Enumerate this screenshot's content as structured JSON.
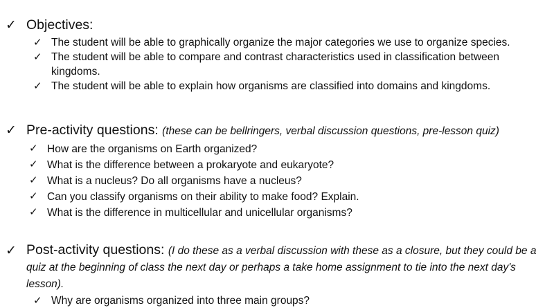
{
  "icons": {
    "bullet": "checkmark-icon"
  },
  "check_glyph": "✓",
  "objectives": {
    "heading": "Objectives:",
    "items": [
      "The student will be able to graphically organize the major categories we use to organize species.",
      "The student will be able to compare and contrast characteristics used in classification between kingdoms.",
      "The student will be able to explain how organisms are classified into domains and kingdoms."
    ]
  },
  "pre_activity": {
    "heading": "Pre-activity questions:",
    "note": "(these can be bellringers, verbal discussion questions, pre-lesson quiz)",
    "items": [
      "How are the organisms on Earth organized?",
      "What is the difference between a prokaryote and eukaryote?",
      "What is a nucleus? Do all organisms have a nucleus?",
      "Can you classify organisms on their ability to make food? Explain.",
      "What is the difference in multicellular and unicellular organisms?"
    ]
  },
  "post_activity": {
    "heading": "Post-activity questions:",
    "note": "(I do these as a verbal discussion with these as a closure, but they could be a quiz at the beginning of class the next day or perhaps a take home assignment to tie into the next day's lesson).",
    "items": [
      "Why are organisms organized into three main groups?"
    ]
  }
}
